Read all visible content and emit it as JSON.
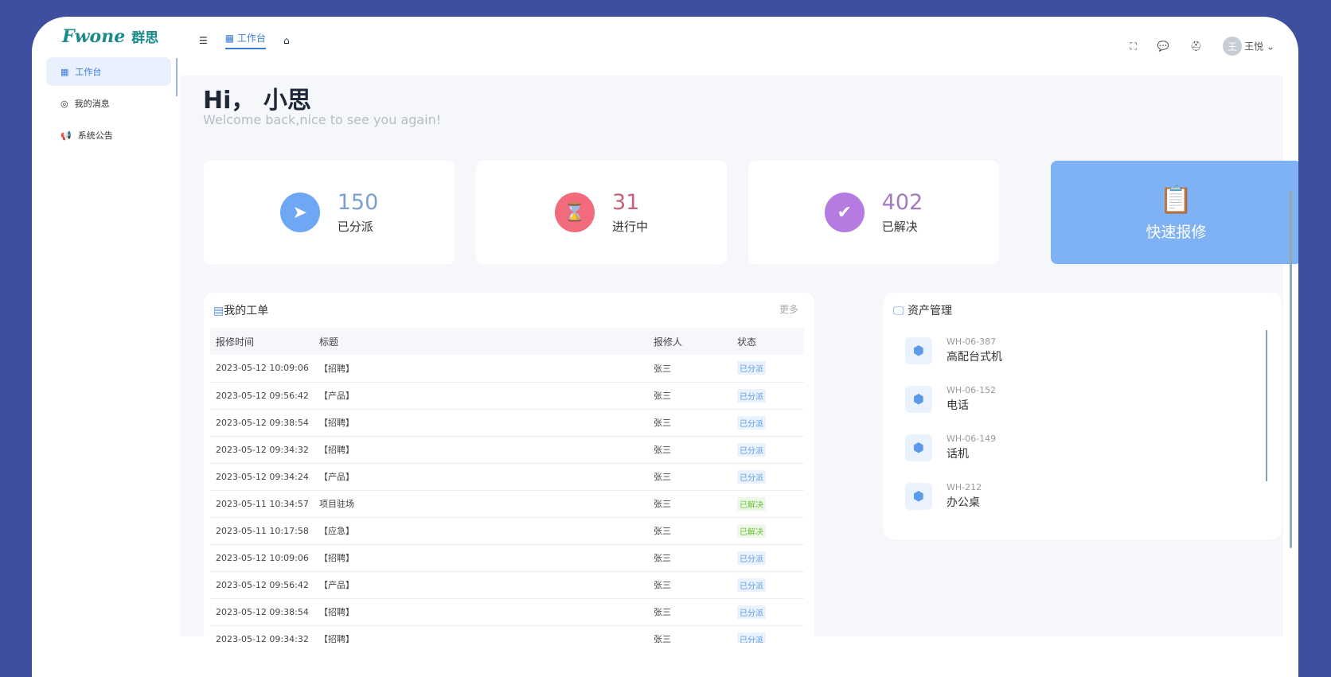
{
  "header": {
    "logo": "Fwone",
    "logo_cn": "群思",
    "nav_active": "工作台",
    "user": "王悦",
    "avatar_char": "王"
  },
  "sidebar": {
    "items": [
      {
        "label": "工作台",
        "icon": "grid-icon"
      },
      {
        "label": "我的消息",
        "icon": "message-icon"
      },
      {
        "label": "系统公告",
        "icon": "megaphone-icon"
      }
    ]
  },
  "tabs": [
    {
      "label": "工作台"
    },
    {
      "label": "首页"
    }
  ],
  "greeting": {
    "title": "Hi， 小思",
    "subtitle": "Welcome back,nice to see you again!"
  },
  "stats": [
    {
      "value": "150",
      "label": "已分派",
      "color": "#6ea8f5",
      "numColor": "#7b9fd0"
    },
    {
      "value": "31",
      "label": "进行中",
      "color": "#f26b7d",
      "numColor": "#c8607a"
    },
    {
      "value": "402",
      "label": "已解决",
      "color": "#b57be0",
      "numColor": "#a17ac0"
    }
  ],
  "quick_repair": {
    "label": "快速报修"
  },
  "orders": {
    "title": "我的工单",
    "more": "更多",
    "columns": [
      "报修时间",
      "标题",
      "报修人",
      "状态"
    ],
    "rows": [
      [
        "2023-05-12  10:09:06",
        "【招聘】",
        "张三",
        "已分派"
      ],
      [
        "2023-05-12  09:56:42",
        "【产品】",
        "张三",
        "已分派"
      ],
      [
        "2023-05-12  09:38:54",
        "【招聘】",
        "张三",
        "已分派"
      ],
      [
        "2023-05-12  09:34:32",
        "【招聘】",
        "张三",
        "已分派"
      ],
      [
        "2023-05-12  09:34:24",
        "【产品】",
        "张三",
        "已分派"
      ],
      [
        "2023-05-11  10:34:57",
        "项目驻场",
        "张三",
        "已解决"
      ],
      [
        "2023-05-11  10:17:58",
        "【应急】",
        "张三",
        "已解决"
      ],
      [
        "2023-05-12  10:09:06",
        "【招聘】",
        "张三",
        "已分派"
      ],
      [
        "2023-05-12  09:56:42",
        "【产品】",
        "张三",
        "已分派"
      ],
      [
        "2023-05-12  09:38:54",
        "【招聘】",
        "张三",
        "已分派"
      ],
      [
        "2023-05-12  09:34:32",
        "【招聘】",
        "张三",
        "已分派"
      ]
    ]
  },
  "assets": {
    "title": "资产管理",
    "items": [
      {
        "code": "WH-06-387",
        "name": "高配台式机"
      },
      {
        "code": "WH-06-152",
        "name": "电话"
      },
      {
        "code": "WH-06-149",
        "name": "话机"
      },
      {
        "code": "WH-212",
        "name": "办公桌"
      }
    ]
  }
}
